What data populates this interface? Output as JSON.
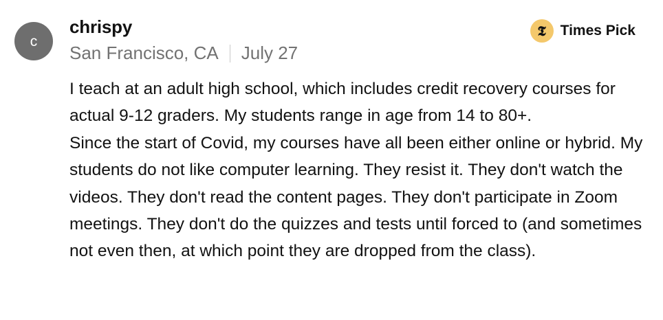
{
  "comment": {
    "avatar_letter": "c",
    "username": "chrispy",
    "location": "San Francisco, CA",
    "date": "July 27",
    "badge": {
      "icon": "nyt-t-logo-icon",
      "icon_glyph": "𝕿",
      "label": "Times Pick",
      "color": "#f4c86b"
    },
    "paragraphs": [
      "I teach at an adult high school, which includes credit recovery courses for actual 9-12 graders. My students range in age from 14 to 80+.",
      "Since the start of Covid, my courses have all been either online or hybrid. My students do not like computer learning. They resist it. They don't watch the videos. They don't read the content pages. They don't participate in Zoom meetings. They don't do the quizzes and tests until forced to (and sometimes not even then, at which point they are dropped from the class)."
    ]
  }
}
